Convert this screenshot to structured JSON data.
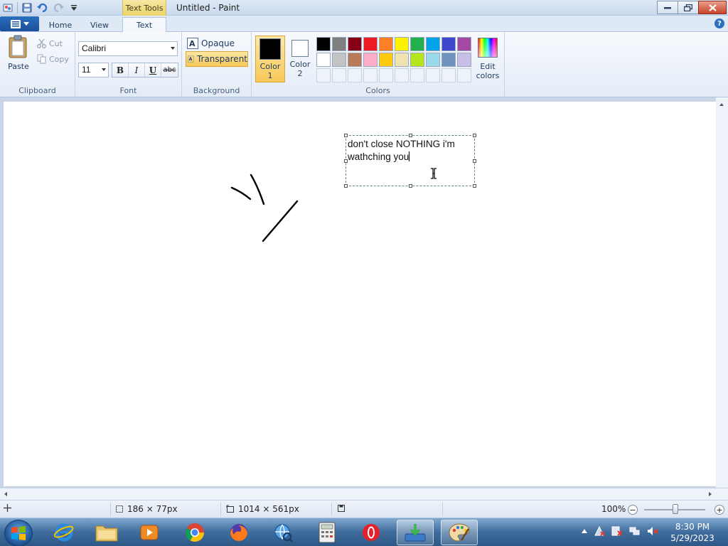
{
  "window": {
    "title": "Untitled - Paint",
    "context_tab": "Text Tools"
  },
  "tabs": {
    "home": "Home",
    "view": "View",
    "text": "Text"
  },
  "clipboard": {
    "paste": "Paste",
    "cut": "Cut",
    "copy": "Copy",
    "label": "Clipboard"
  },
  "font": {
    "name": "Calibri",
    "size": "11",
    "bold": "B",
    "italic": "I",
    "underline": "U",
    "strikethrough": "abc",
    "label": "Font"
  },
  "background": {
    "opaque": "Opaque",
    "transparent": "Transparent",
    "label": "Background"
  },
  "colors": {
    "color1_label_a": "Color",
    "color1_label_b": "1",
    "color2_label_a": "Color",
    "color2_label_b": "2",
    "color1": "#000000",
    "color2": "#ffffff",
    "edit_a": "Edit",
    "edit_b": "colors",
    "label": "Colors",
    "palette_row1": [
      "#000000",
      "#7f7f7f",
      "#880015",
      "#ed1c24",
      "#ff7f27",
      "#fff200",
      "#22b14c",
      "#00a2e8",
      "#3f48cc",
      "#a349a4"
    ],
    "palette_row2": [
      "#ffffff",
      "#c3c3c3",
      "#b97a57",
      "#ffaec9",
      "#ffc90e",
      "#efe4b0",
      "#b5e61d",
      "#99d9ea",
      "#7092be",
      "#c8bfe7"
    ]
  },
  "canvas": {
    "text_line1": "don't close NOTHING i'm",
    "text_line2": "wathching you"
  },
  "status": {
    "selection_size": "186 × 77px",
    "canvas_size": "1014 × 561px",
    "zoom": "100%"
  },
  "taskbar": {
    "time": "8:30 PM",
    "date": "5/29/2023"
  }
}
